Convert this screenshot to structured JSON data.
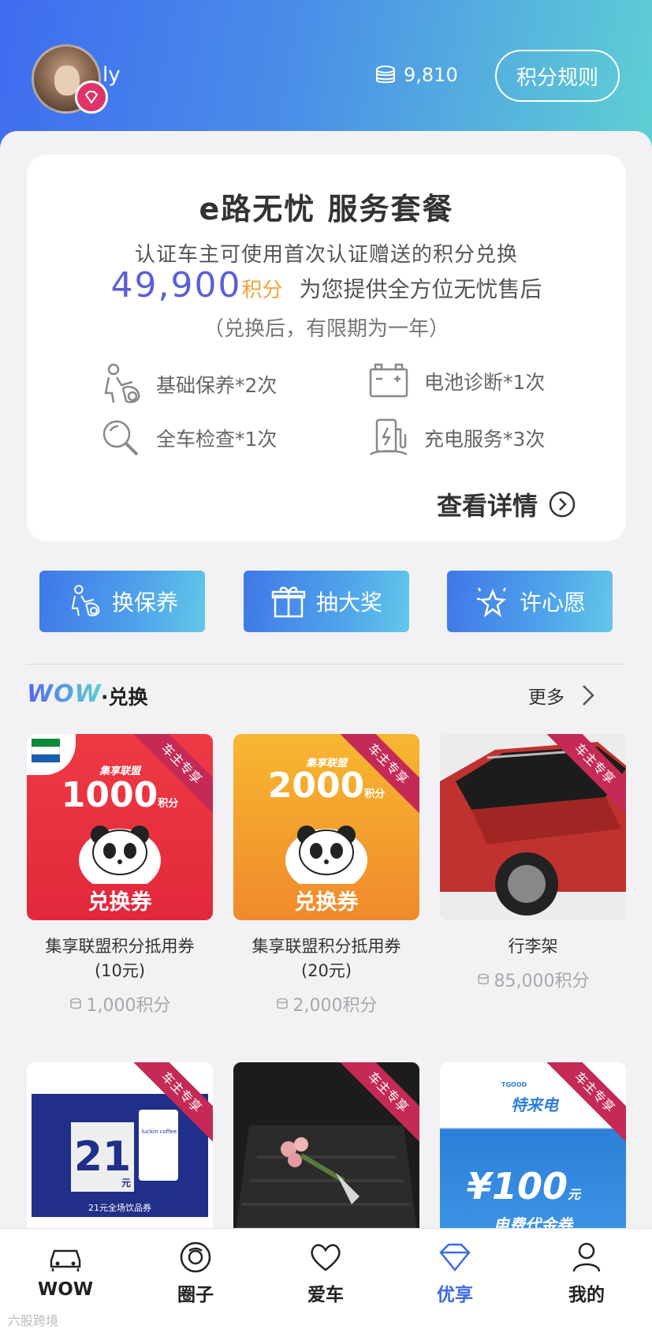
{
  "header": {
    "username": "ly",
    "points": "9,810",
    "rules_button": "积分规则"
  },
  "package": {
    "title": "e路无忧 服务套餐",
    "desc": "认证车主可使用首次认证赠送的积分兑换",
    "points_value": "49,900",
    "points_unit": "积分",
    "desc_tail": "为您提供全方位无忧售后",
    "validity": "（兑换后，有限期为一年）",
    "services": [
      {
        "label": "基础保养*2次",
        "icon": "maintenance-icon"
      },
      {
        "label": "电池诊断*1次",
        "icon": "battery-icon"
      },
      {
        "label": "全车检查*1次",
        "icon": "magnifier-icon"
      },
      {
        "label": "充电服务*3次",
        "icon": "charging-icon"
      }
    ],
    "details_link": "查看详情"
  },
  "actions": [
    {
      "label": "换保养",
      "icon": "maintenance-icon"
    },
    {
      "label": "抽大奖",
      "icon": "gift-icon"
    },
    {
      "label": "许心愿",
      "icon": "wish-star-icon"
    }
  ],
  "section": {
    "logo": "WOW",
    "title": "·兑换",
    "more": "更多"
  },
  "ribbon_label": "车主专享",
  "products": [
    {
      "name": "集享联盟积分抵用券\n(10元)",
      "price": "1,000积分",
      "coupon_brand": "集享联盟",
      "coupon_amount": "1000",
      "coupon_unit": "积分",
      "coupon_label": "兑换券"
    },
    {
      "name": "集享联盟积分抵用券\n(20元)",
      "price": "2,000积分",
      "coupon_brand": "集享联盟",
      "coupon_amount": "2000",
      "coupon_unit": "积分",
      "coupon_label": "兑换券"
    },
    {
      "name": "行李架",
      "price": "85,000积分"
    }
  ],
  "products_row2": [
    {
      "coupon_amount": "21",
      "coupon_unit": "元",
      "coupon_text": "21元全场饮品券",
      "brand": "luckin coffee"
    },
    {},
    {
      "brand": "特来电",
      "brand_en": "TGOOD",
      "coupon_amount": "¥100",
      "coupon_unit": "元",
      "coupon_text": "电费代金券"
    }
  ],
  "tabbar": [
    {
      "label": "WOW",
      "icon": "car-icon",
      "active": false
    },
    {
      "label": "圈子",
      "icon": "circle-icon",
      "active": false
    },
    {
      "label": "爱车",
      "icon": "heart-icon",
      "active": false
    },
    {
      "label": "优享",
      "icon": "diamond-icon",
      "active": true
    },
    {
      "label": "我的",
      "icon": "person-icon",
      "active": false
    }
  ],
  "watermark": "六股跨境",
  "colors": {
    "accent": "#3d6be6",
    "points_number": "#5b5fd6",
    "points_unit": "#f0a23a",
    "ribbon": "#c42a55"
  }
}
